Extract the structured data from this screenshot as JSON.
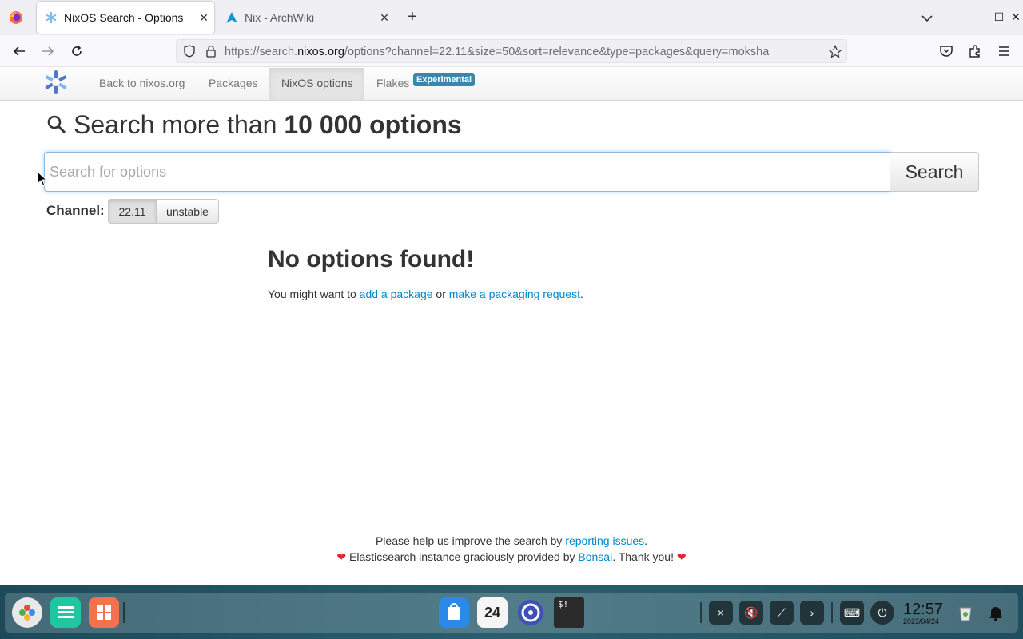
{
  "browser": {
    "tabs": [
      {
        "title": "NixOS Search - Options",
        "active": true
      },
      {
        "title": "Nix - ArchWiki",
        "active": false
      }
    ],
    "url_prefix": "https://search.",
    "url_domain": "nixos.org",
    "url_rest": "/options?channel=22.11&size=50&sort=relevance&type=packages&query=moksha"
  },
  "site_nav": {
    "back_label": "Back to nixos.org",
    "packages_label": "Packages",
    "options_label": "NixOS options",
    "flakes_label": "Flakes",
    "flakes_badge": "Experimental"
  },
  "search": {
    "heading_prefix": "Search more than",
    "heading_count": "10 000 options",
    "placeholder": "Search for options",
    "value": "",
    "button_label": "Search"
  },
  "channel": {
    "label": "Channel:",
    "options": [
      "22.11",
      "unstable"
    ],
    "selected": "22.11"
  },
  "results": {
    "empty_title": "No options found!",
    "msg_prefix": "You might want to",
    "link_add": "add a package",
    "msg_or": "or",
    "link_request": "make a packaging request",
    "msg_suffix": "."
  },
  "footer": {
    "line1_prefix": "Please help us improve the search by",
    "line1_link": "reporting issues",
    "line1_suffix": ".",
    "line2_prefix": "Elasticsearch instance graciously provided by",
    "line2_link": "Bonsai",
    "line2_suffix": ". Thank you!"
  },
  "taskbar": {
    "calendar_day": "24",
    "terminal_glyph": "$!",
    "time": "12:57",
    "date": "2023/04/24"
  },
  "colors": {
    "link": "#0088cc",
    "badge": "#3a87ad",
    "heart": "#e02a2a"
  }
}
